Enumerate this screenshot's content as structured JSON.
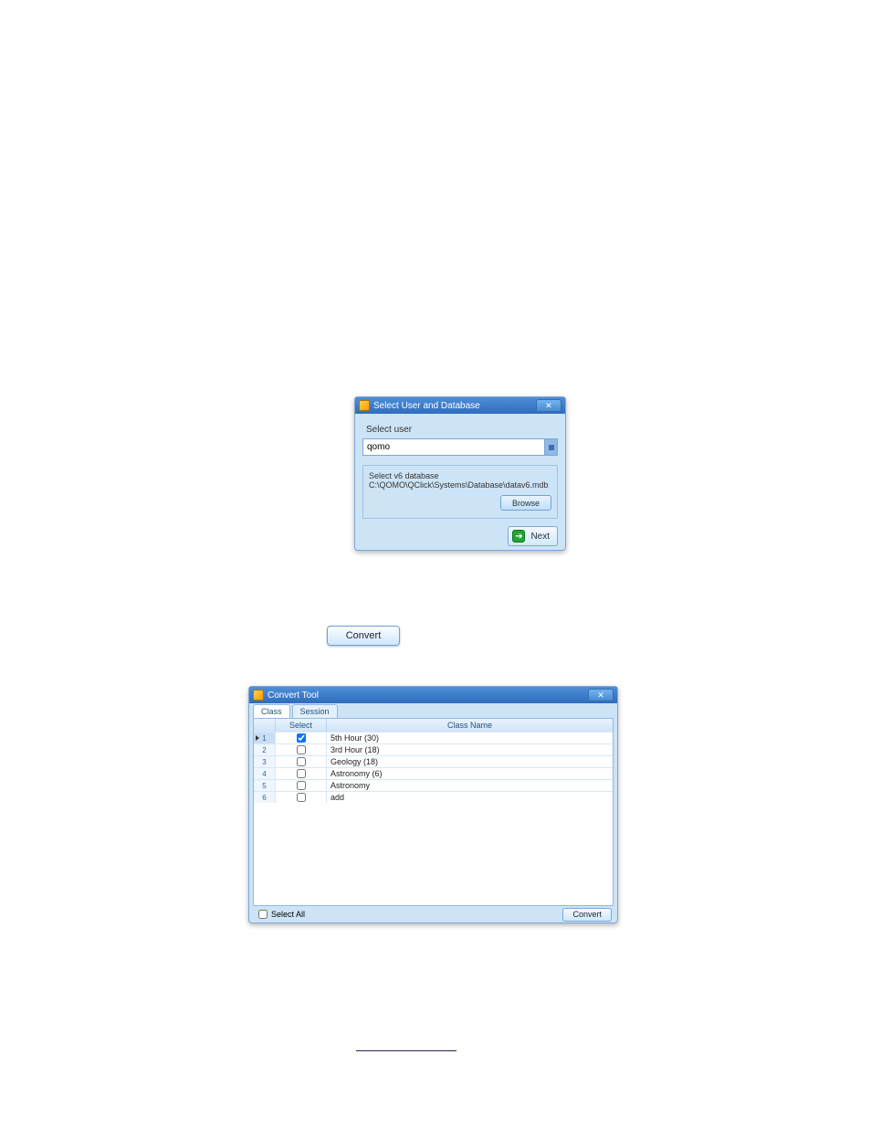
{
  "dlg1": {
    "title": "Select User and Database",
    "select_user_label": "Select user",
    "user_value": "qomo",
    "db_label": "Select v6 database",
    "db_path": "C:\\QOMO\\QClick\\Systems\\Database\\datav6.mdb",
    "browse_label": "Browse",
    "next_label": "Next"
  },
  "convert_btn_label": "Convert",
  "dlg2": {
    "title": "Convert Tool",
    "tabs": {
      "class": "Class",
      "session": "Session"
    },
    "columns": {
      "select": "Select",
      "name": "Class Name"
    },
    "rows": [
      {
        "n": "1",
        "checked": true,
        "name": "5th Hour (30)",
        "current": true
      },
      {
        "n": "2",
        "checked": false,
        "name": "3rd Hour (18)"
      },
      {
        "n": "3",
        "checked": false,
        "name": "Geology (18)"
      },
      {
        "n": "4",
        "checked": false,
        "name": "Astronomy (6)"
      },
      {
        "n": "5",
        "checked": false,
        "name": "Astronomy"
      },
      {
        "n": "6",
        "checked": false,
        "name": "add"
      }
    ],
    "select_all_label": "Select All",
    "convert_label": "Convert"
  }
}
